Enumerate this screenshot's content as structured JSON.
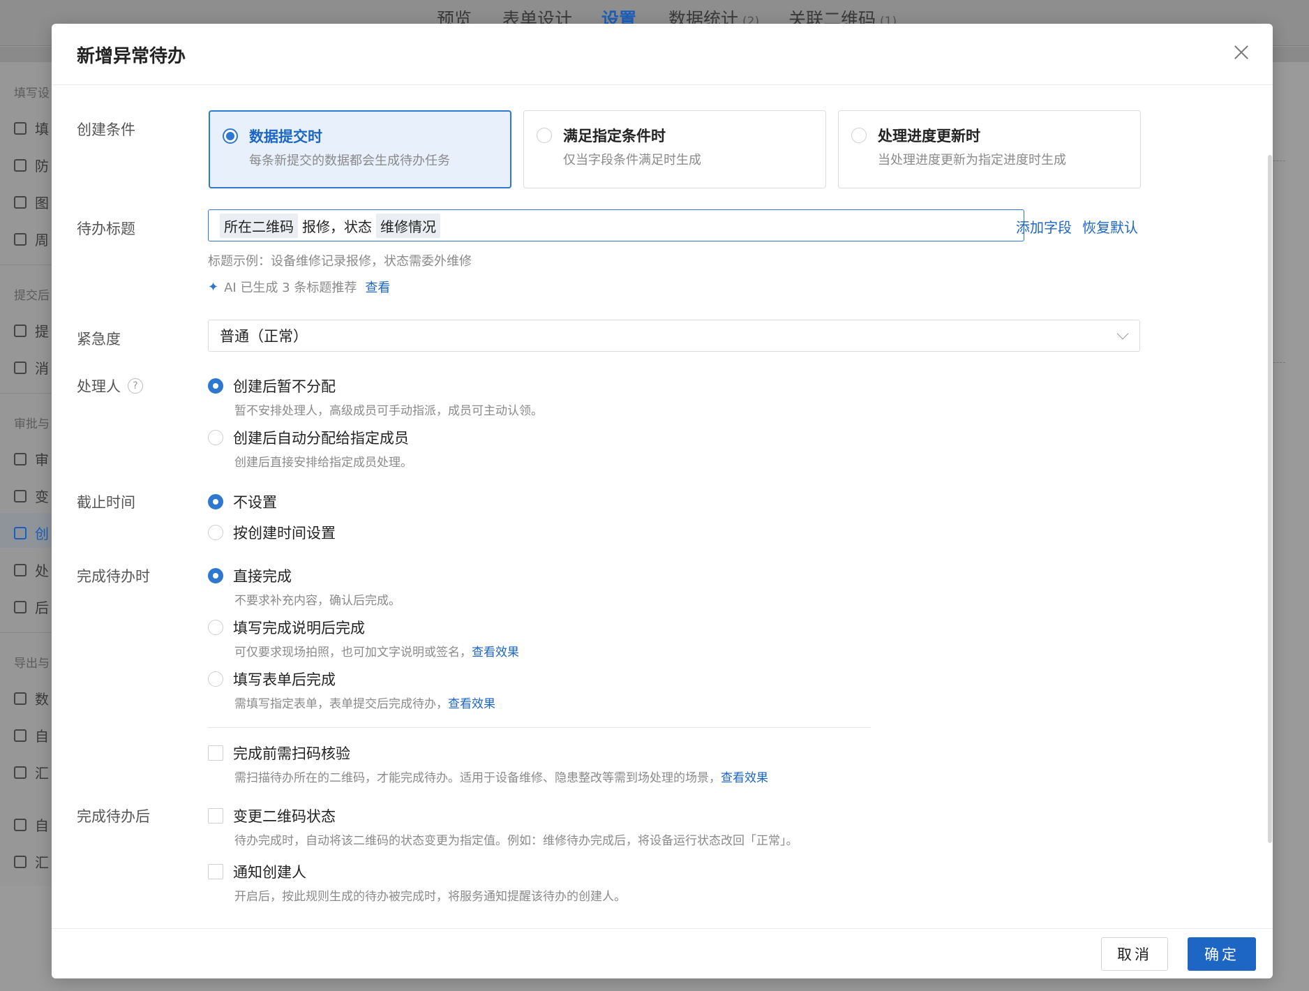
{
  "background": {
    "tabs": [
      {
        "label": "预览",
        "count": ""
      },
      {
        "label": "表单设计",
        "count": ""
      },
      {
        "label": "设置",
        "count": ""
      },
      {
        "label": "数据统计",
        "count": "(2)"
      },
      {
        "label": "关联二维码",
        "count": "(1)"
      }
    ],
    "sidebar": {
      "sections": [
        "填写设",
        "提交后",
        "审批与",
        "导出与"
      ],
      "items": [
        "填",
        "防",
        "图",
        "周",
        "提",
        "消",
        "审",
        "变",
        "创",
        "处",
        "后",
        "数",
        "自",
        "汇",
        "自",
        "汇"
      ]
    }
  },
  "modal": {
    "title": "新增异常待办",
    "create_condition": {
      "label": "创建条件",
      "cards": [
        {
          "title": "数据提交时",
          "desc": "每条新提交的数据都会生成待办任务"
        },
        {
          "title": "满足指定条件时",
          "desc": "仅当字段条件满足时生成"
        },
        {
          "title": "处理进度更新时",
          "desc": "当处理进度更新为指定进度时生成"
        }
      ]
    },
    "todo_title": {
      "label": "待办标题",
      "tag1": "所在二维码",
      "text1": "报修，状态",
      "tag2": "维修情况",
      "add_field": "添加字段",
      "restore_default": "恢复默认",
      "example": "标题示例：设备维修记录报修，状态需委外维修",
      "ai_text": "AI 已生成 3 条标题推荐",
      "ai_link": "查看"
    },
    "urgency": {
      "label": "紧急度",
      "value": "普通（正常）"
    },
    "handler": {
      "label": "处理人",
      "help": "?",
      "options": [
        {
          "label": "创建后暂不分配",
          "desc": "暂不安排处理人，高级成员可手动指派，成员可主动认领。"
        },
        {
          "label": "创建后自动分配给指定成员",
          "desc": "创建后直接安排给指定成员处理。"
        }
      ]
    },
    "deadline": {
      "label": "截止时间",
      "options": [
        "不设置",
        "按创建时间设置"
      ]
    },
    "on_complete": {
      "label": "完成待办时",
      "options": [
        {
          "label": "直接完成",
          "desc": "不要求补充内容，确认后完成。",
          "link": ""
        },
        {
          "label": "填写完成说明后完成",
          "desc": "可仅要求现场拍照，也可加文字说明或签名，",
          "link": "查看效果"
        },
        {
          "label": "填写表单后完成",
          "desc": "需填写指定表单，表单提交后完成待办，",
          "link": "查看效果"
        }
      ],
      "scan": {
        "label": "完成前需扫码核验",
        "desc": "需扫描待办所在的二维码，才能完成待办。适用于设备维修、隐患整改等需到场处理的场景，",
        "link": "查看效果"
      }
    },
    "after_complete": {
      "label": "完成待办后",
      "options": [
        {
          "label": "变更二维码状态",
          "desc": "待办完成时，自动将该二维码的状态变更为指定值。例如：维修待办完成后，将设备运行状态改回「正常」。"
        },
        {
          "label": "通知创建人",
          "desc": "开启后，按此规则生成的待办被完成时，将服务通知提醒该待办的创建人。"
        }
      ]
    },
    "footer": {
      "cancel": "取消",
      "ok": "确定"
    }
  },
  "colors": {
    "accent": "#2f78d0",
    "primary_button": "#1d66c4",
    "overlay": "#9a9a9a"
  }
}
